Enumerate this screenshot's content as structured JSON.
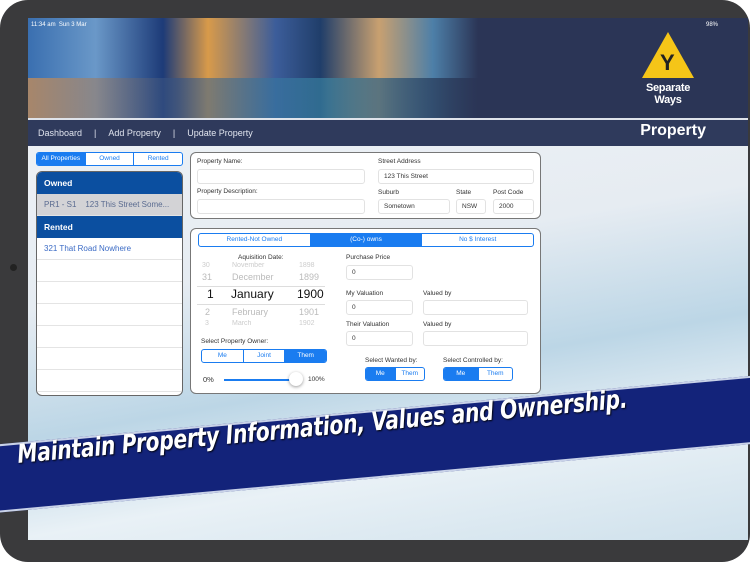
{
  "status": {
    "time": "11:34 am",
    "date": "Sun 3 Mar",
    "battery": "98%"
  },
  "brand": {
    "name": "Separate Ways",
    "accent": "#f5c518"
  },
  "nav": {
    "items": [
      "Dashboard",
      "Add Property",
      "Update Property"
    ],
    "separator": "|",
    "title": "Property"
  },
  "filter": {
    "options": [
      "All Properties",
      "Owned",
      "Rented"
    ],
    "selected": "All Properties"
  },
  "list": {
    "owned_header": "Owned",
    "owned_items": [
      "PR1 - S1    123 This Street Some..."
    ],
    "rented_header": "Rented",
    "rented_items": [
      "321 That Road Nowhere"
    ]
  },
  "form": {
    "property_name_label": "Property Name:",
    "property_name": "",
    "description_label": "Property Description:",
    "description": "",
    "street_label": "Street Address",
    "street": "123 This Street",
    "suburb_label": "Suburb",
    "suburb": "Sometown",
    "state_label": "State",
    "state": "NSW",
    "postcode_label": "Post Code",
    "postcode": "2000"
  },
  "ownership": {
    "tabs": [
      "Rented-Not Owned",
      "(Co-) owns",
      "No $ Interest"
    ],
    "selected": "(Co-) owns",
    "acq_label": "Aquisition Date:",
    "picker": [
      [
        "30",
        "November",
        "1898"
      ],
      [
        "31",
        "December",
        "1899"
      ],
      [
        "1",
        "January",
        "1900"
      ],
      [
        "2",
        "February",
        "1901"
      ],
      [
        "3",
        "March",
        "1902"
      ]
    ],
    "owner_label": "Select Property Owner:",
    "owner_options": [
      "Me",
      "Joint",
      "Them"
    ],
    "owner_selected": "Them",
    "slider_min": "0%",
    "slider_max": "100%",
    "slider_value": 100,
    "purchase_label": "Purchase Price",
    "purchase": "0",
    "my_val_label": "My Valuation",
    "my_val": "0",
    "their_val_label": "Their Valuation",
    "their_val": "0",
    "valued_by_label": "Valued by",
    "valued_by_1": "",
    "valued_by_2": "",
    "wanted_label": "Select Wanted by:",
    "wanted_options": [
      "Me",
      "Them"
    ],
    "controlled_label": "Select Controlled by:",
    "controlled_options": [
      "Me",
      "Them"
    ]
  },
  "promo": "Maintain Property Information, Values and Ownership."
}
